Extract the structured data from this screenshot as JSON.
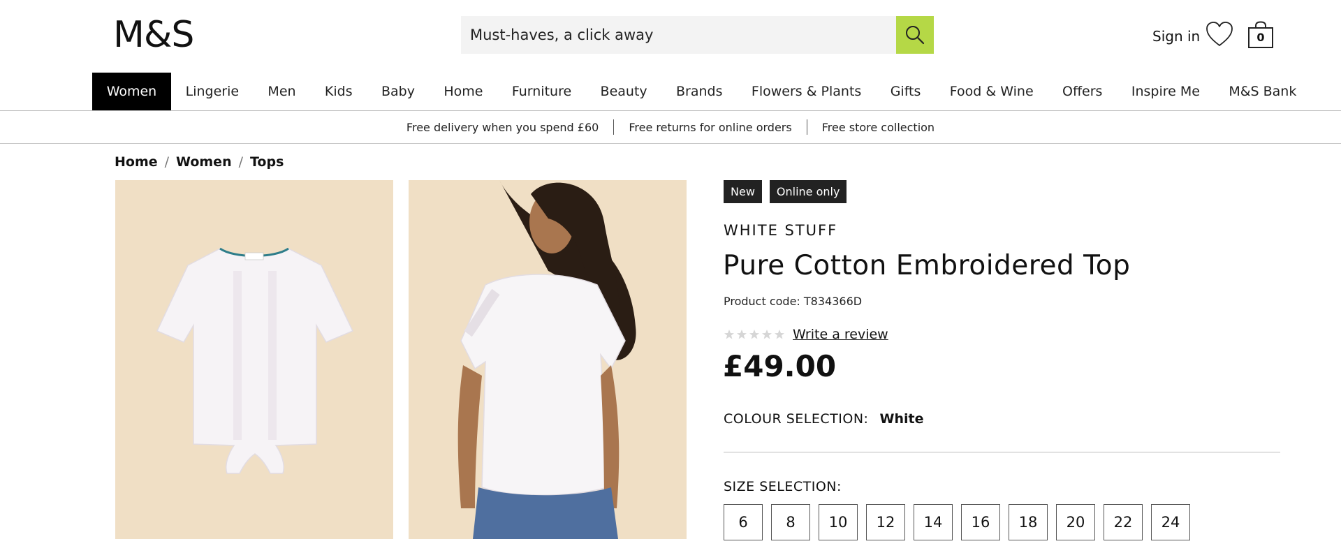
{
  "header": {
    "logo": "M&S",
    "search_placeholder": "Must-haves, a click away",
    "sign_in": "Sign in",
    "bag_count": "0"
  },
  "nav": {
    "items": [
      "Women",
      "Lingerie",
      "Men",
      "Kids",
      "Baby",
      "Home",
      "Furniture",
      "Beauty",
      "Brands",
      "Flowers & Plants",
      "Gifts",
      "Food & Wine",
      "Offers",
      "Inspire Me",
      "M&S Bank"
    ],
    "active": "Women"
  },
  "promo": {
    "items": [
      "Free delivery when you spend £60",
      "Free returns for online orders",
      "Free store collection"
    ]
  },
  "breadcrumb": {
    "items": [
      "Home",
      "Women",
      "Tops"
    ]
  },
  "product": {
    "badges": [
      "New",
      "Online only"
    ],
    "brand": "WHITE STUFF",
    "title": "Pure Cotton Embroidered Top",
    "code": "Product code: T834366D",
    "rating": 0,
    "review_link": "Write a review",
    "price": "£49.00",
    "colour_label": "COLOUR SELECTION:",
    "colour_value": "White",
    "size_label": "SIZE SELECTION:",
    "sizes": [
      "6",
      "8",
      "10",
      "12",
      "14",
      "16",
      "18",
      "20",
      "22",
      "24"
    ]
  },
  "colors": {
    "search_button": "#b5d846",
    "image_background": "#f0dfc5",
    "badge_background": "#222222",
    "nav_active_background": "#000000"
  },
  "icons": {
    "search": "search-icon",
    "wishlist": "heart-icon",
    "bag": "shopping-bag-icon",
    "rating": "star-icon"
  }
}
